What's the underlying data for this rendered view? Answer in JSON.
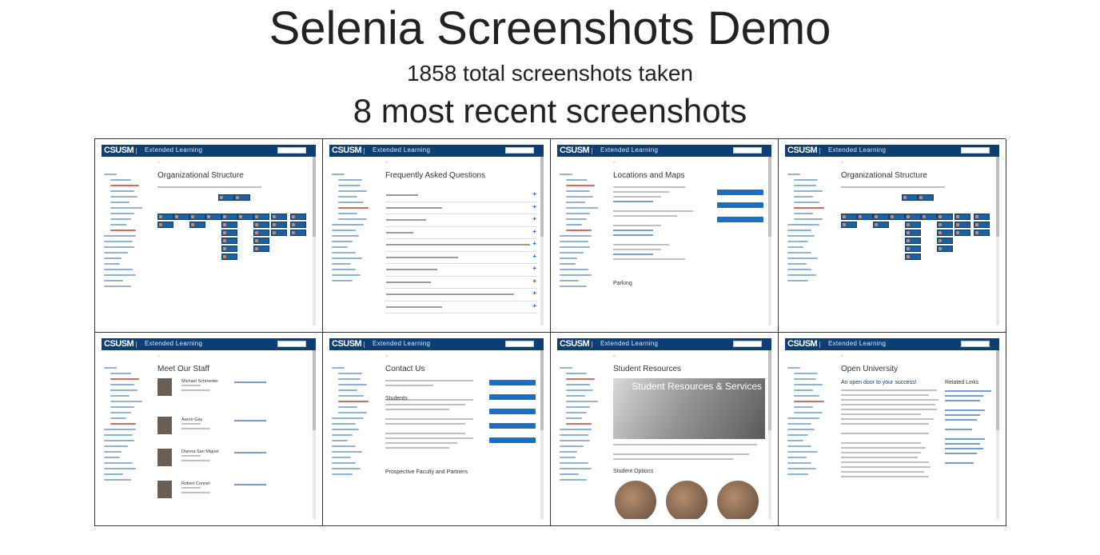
{
  "header": {
    "title": "Selenia Screenshots Demo",
    "total": "1858 total screenshots taken",
    "recent": "8 most recent screenshots"
  },
  "colors": {
    "csusm_blue": "#0d3f74",
    "link_blue": "#1a5aa6",
    "button_blue": "#1a6fc4"
  },
  "screenshots": [
    {
      "logo": "CSUSM",
      "dept": "Extended Learning",
      "heading": "Organizational Structure",
      "kind": "org"
    },
    {
      "logo": "CSUSM",
      "dept": "Extended Learning",
      "heading": "Frequently Asked Questions",
      "kind": "faq"
    },
    {
      "logo": "CSUSM",
      "dept": "Extended Learning",
      "heading": "Locations and Maps",
      "kind": "locations",
      "subheading": "Parking"
    },
    {
      "logo": "CSUSM",
      "dept": "Extended Learning",
      "heading": "Organizational Structure",
      "kind": "org"
    },
    {
      "logo": "CSUSM",
      "dept": "Extended Learning",
      "heading": "Meet Our Staff",
      "kind": "staff",
      "staff": [
        "Michael Schroeder",
        "Aaron Gay",
        "Dianna San Miguel",
        "Robert Conner"
      ]
    },
    {
      "logo": "CSUSM",
      "dept": "Extended Learning",
      "heading": "Contact Us",
      "kind": "contact",
      "subheadings": [
        "Students",
        "Prospective Faculty and Partners"
      ]
    },
    {
      "logo": "CSUSM",
      "dept": "Extended Learning",
      "heading": "Student Resources",
      "kind": "resources",
      "hero_text": "Student Resources & Services",
      "subheading": "Student Options"
    },
    {
      "logo": "CSUSM",
      "dept": "Extended Learning",
      "heading": "Open University",
      "kind": "open",
      "subheading": "An open door to your success!",
      "related": "Related Links"
    }
  ]
}
